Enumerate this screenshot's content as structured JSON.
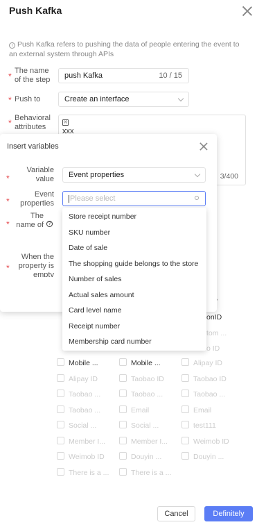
{
  "dialog": {
    "title": "Push Kafka",
    "info": "Push Kafka refers to pushing the data of people entering the event to an external system through APIs",
    "step_name_label": "The name of the step",
    "step_name_value": "push Kafka",
    "step_name_count": "10 / 15",
    "push_to_label": "Push to",
    "push_to_value": "Create an interface",
    "behavioral_label": "Behavioral attributes",
    "behavioral_value": "xxx",
    "behavioral_count": "3/400",
    "cancel_label": "Cancel",
    "confirm_label": "Definitely",
    "accent_color": "#5b7df5"
  },
  "attribute_grid": {
    "col3_partials": [
      "onID",
      "tom ...",
      "o ID"
    ],
    "rows": [
      [
        {
          "label": "Mobile ...",
          "enabled": true
        },
        {
          "label": "Mobile ...",
          "enabled": true
        },
        {
          "label": "Alipay ID",
          "enabled": false
        }
      ],
      [
        {
          "label": "Alipay ID",
          "enabled": false
        },
        {
          "label": "Taobao ID",
          "enabled": false
        },
        {
          "label": "Taobao ID",
          "enabled": false
        }
      ],
      [
        {
          "label": "Taobao ...",
          "enabled": false
        },
        {
          "label": "Taobao ...",
          "enabled": false
        },
        {
          "label": "Taobao ...",
          "enabled": false
        }
      ],
      [
        {
          "label": "Taobao ...",
          "enabled": false
        },
        {
          "label": "Email",
          "enabled": false
        },
        {
          "label": "Email",
          "enabled": false
        }
      ],
      [
        {
          "label": "Social ...",
          "enabled": false
        },
        {
          "label": "Social ...",
          "enabled": false
        },
        {
          "label": "test111",
          "enabled": false
        }
      ],
      [
        {
          "label": "Member I...",
          "enabled": false
        },
        {
          "label": "Member I...",
          "enabled": false
        },
        {
          "label": "Weimob ID",
          "enabled": false
        }
      ],
      [
        {
          "label": "Weimob ID",
          "enabled": false
        },
        {
          "label": "Douyin ...",
          "enabled": false
        },
        {
          "label": "Douyin ...",
          "enabled": false
        }
      ],
      [
        {
          "label": "There is a ...",
          "enabled": false
        },
        {
          "label": "There is a ...",
          "enabled": false
        },
        null
      ]
    ]
  },
  "insert_variables": {
    "title": "Insert variables",
    "variable_value_label": "Variable value",
    "variable_value_selected": "Event properties",
    "event_properties_label": "Event properties",
    "event_properties_placeholder": "Please select",
    "name_label": "The name of the",
    "empty_label": "When the property is empty"
  },
  "dropdown_options": [
    "Store receipt number",
    "SKU number",
    "Date of sale",
    "The shopping guide belongs to the store",
    "Number of sales",
    "Actual sales amount",
    "Card level name",
    "Receipt number",
    "Membership card number"
  ]
}
